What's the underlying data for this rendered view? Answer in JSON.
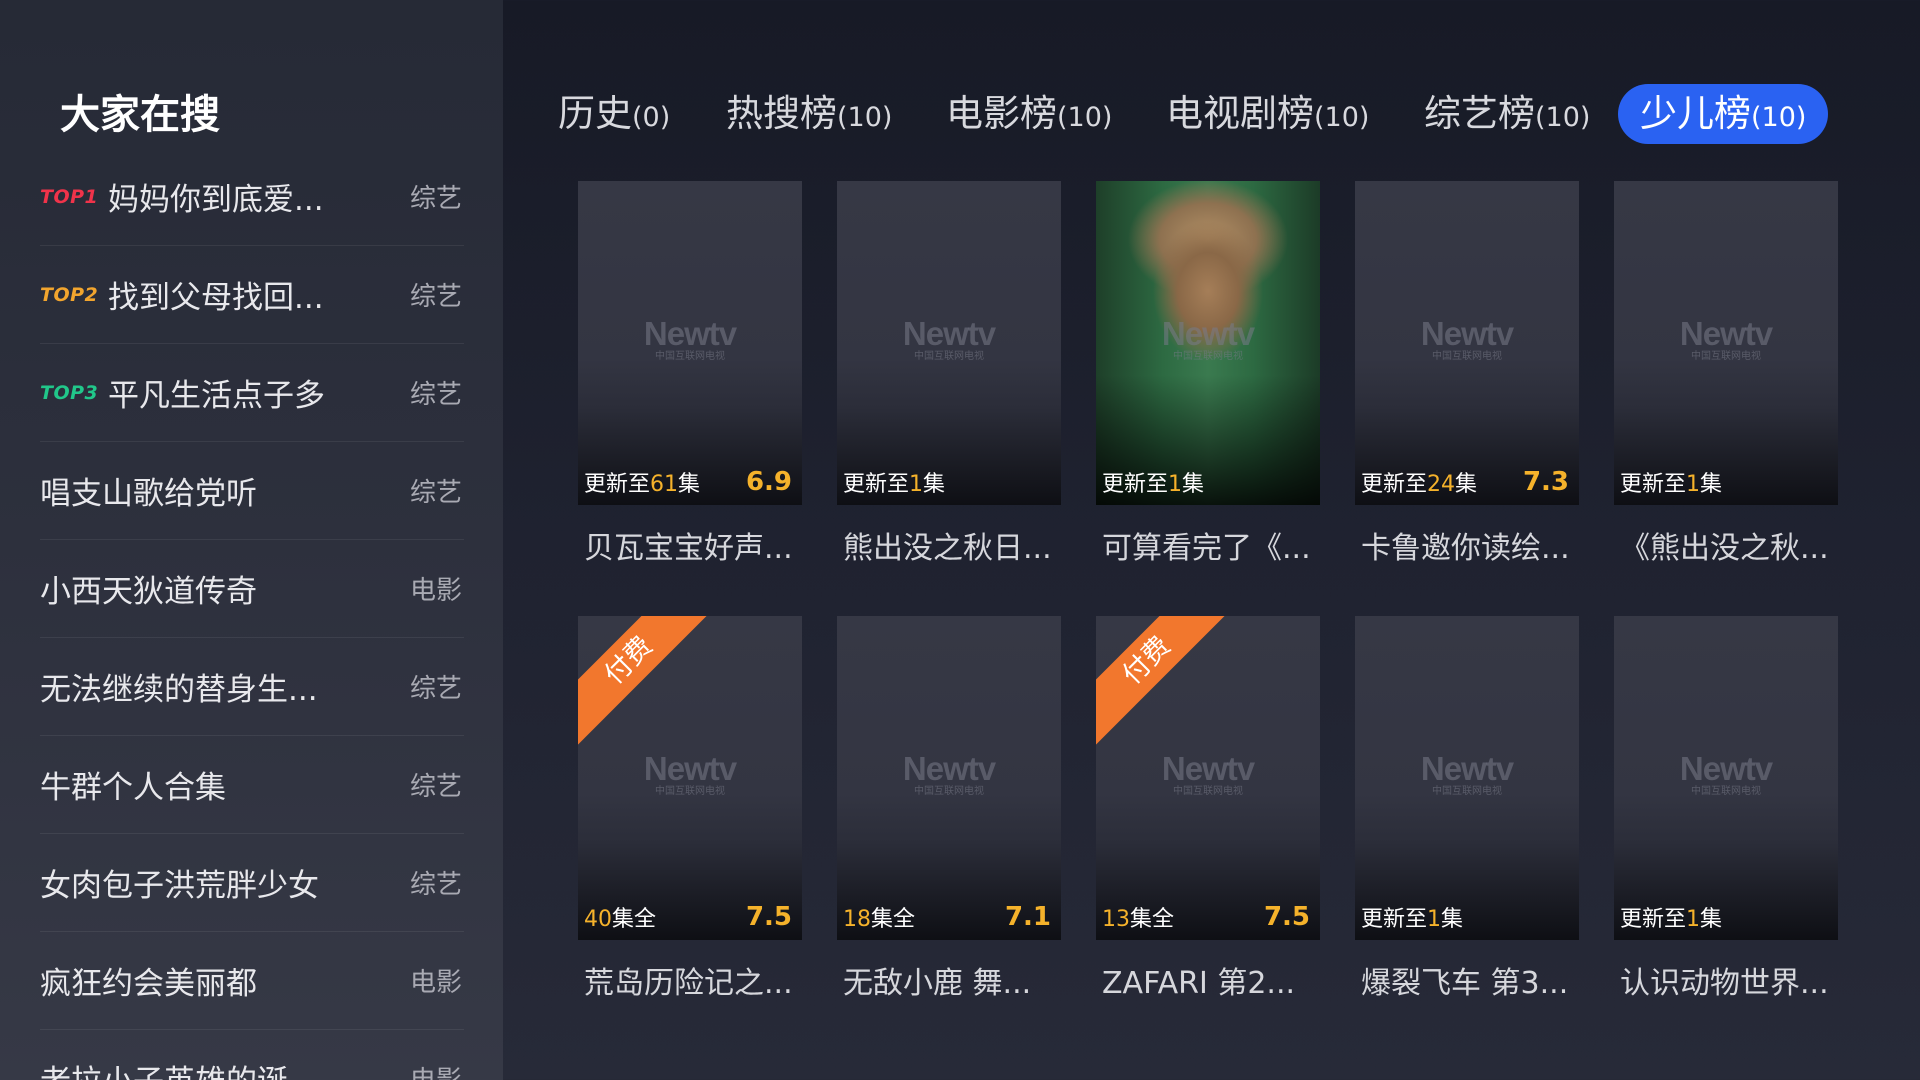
{
  "sidebar": {
    "title": "大家在搜",
    "items": [
      {
        "rank": "TOP1",
        "title": "妈妈你到底爱...",
        "category": "综艺"
      },
      {
        "rank": "TOP2",
        "title": "找到父母找回...",
        "category": "综艺"
      },
      {
        "rank": "TOP3",
        "title": "平凡生活点子多",
        "category": "综艺"
      },
      {
        "rank": "",
        "title": "唱支山歌给党听",
        "category": "综艺"
      },
      {
        "rank": "",
        "title": "小西天狄道传奇",
        "category": "电影"
      },
      {
        "rank": "",
        "title": "无法继续的替身生...",
        "category": "综艺"
      },
      {
        "rank": "",
        "title": "牛群个人合集",
        "category": "综艺"
      },
      {
        "rank": "",
        "title": "女肉包子洪荒胖少女",
        "category": "综艺"
      },
      {
        "rank": "",
        "title": "疯狂约会美丽都",
        "category": "电影"
      },
      {
        "rank": "",
        "title": "老拉小子英雄的诞",
        "category": "电影"
      }
    ]
  },
  "tabs": [
    {
      "label": "历史",
      "count": "(0)"
    },
    {
      "label": "热搜榜",
      "count": "(10)"
    },
    {
      "label": "电影榜",
      "count": "(10)"
    },
    {
      "label": "电视剧榜",
      "count": "(10)"
    },
    {
      "label": "综艺榜",
      "count": "(10)"
    },
    {
      "label": "少儿榜",
      "count": "(10)",
      "active": true
    }
  ],
  "logo": {
    "main": "Newtv",
    "sub": "中国互联网电视"
  },
  "paid_label": "付费",
  "cards": [
    {
      "status_pre": "更新至",
      "status_num": "61",
      "status_post": "集",
      "score": "6.9",
      "title": "贝瓦宝宝好声...",
      "paid": false,
      "art": false
    },
    {
      "status_pre": "更新至",
      "status_num": "1",
      "status_post": "集",
      "score": "",
      "title": "熊出没之秋日...",
      "paid": false,
      "art": false
    },
    {
      "status_pre": "更新至",
      "status_num": "1",
      "status_post": "集",
      "score": "",
      "title": "可算看完了《...",
      "paid": false,
      "art": true
    },
    {
      "status_pre": "更新至",
      "status_num": "24",
      "status_post": "集",
      "score": "7.3",
      "title": "卡鲁邀你读绘...",
      "paid": false,
      "art": false
    },
    {
      "status_pre": "更新至",
      "status_num": "1",
      "status_post": "集",
      "score": "",
      "title": "《熊出没之秋...",
      "paid": false,
      "art": false
    },
    {
      "status_pre": "",
      "status_num": "40",
      "status_post": "集全",
      "score": "7.5",
      "title": "荒岛历险记之...",
      "paid": true,
      "art": false
    },
    {
      "status_pre": "",
      "status_num": "18",
      "status_post": "集全",
      "score": "7.1",
      "title": "无敌小鹿 舞...",
      "paid": false,
      "art": false
    },
    {
      "status_pre": "",
      "status_num": "13",
      "status_post": "集全",
      "score": "7.5",
      "title": "ZAFARI 第2...",
      "paid": true,
      "art": false
    },
    {
      "status_pre": "更新至",
      "status_num": "1",
      "status_post": "集",
      "score": "",
      "title": "爆裂飞车 第3...",
      "paid": false,
      "art": false
    },
    {
      "status_pre": "更新至",
      "status_num": "1",
      "status_post": "集",
      "score": "",
      "title": "认识动物世界...",
      "paid": false,
      "art": false
    }
  ],
  "colors": {
    "accent": "#2a62f2",
    "score": "#f5b22b",
    "paid": "#f2772d",
    "top1": "#f0334a",
    "top2": "#f2a52e",
    "top3": "#21c78a"
  }
}
